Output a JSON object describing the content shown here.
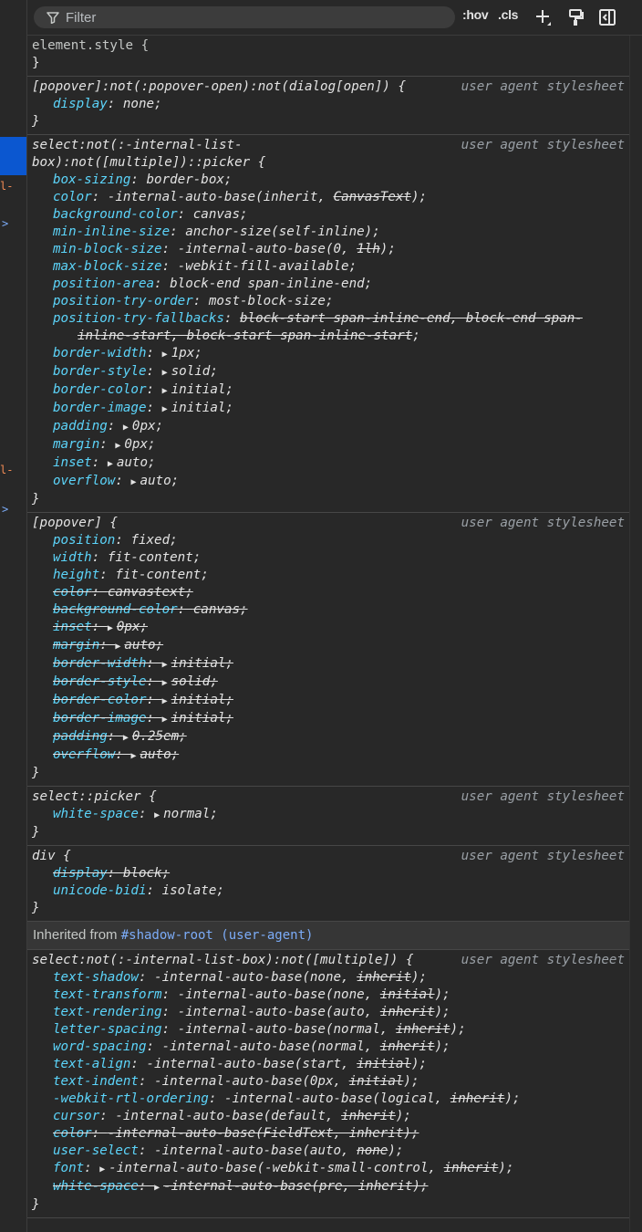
{
  "toolbar": {
    "filter_placeholder": "Filter",
    "hov_label": ":hov",
    "cls_label": ".cls"
  },
  "gutter": {
    "frag1": "l-",
    "frag2": "l-",
    "arrow1": ">",
    "arrow2": ">"
  },
  "rules": [
    {
      "selector": "element.style {",
      "origin": "",
      "close": "}"
    },
    {
      "selector": "[popover]:not(:popover-open):not(dialog[open]) {",
      "origin": "user agent stylesheet",
      "close": "}",
      "decls": [
        {
          "prop": "display",
          "val": "none;"
        }
      ]
    },
    {
      "selector": "select:not(:-internal-list-\nbox):not([multiple])::picker {",
      "origin": "user agent stylesheet",
      "close": "}",
      "decls": [
        {
          "prop": "box-sizing",
          "val": "border-box;"
        },
        {
          "prop": "color",
          "val_pre": "-internal-auto-base(inherit, ",
          "val_strike": "CanvasText",
          "val_post": ");"
        },
        {
          "prop": "background-color",
          "val": "canvas;"
        },
        {
          "prop": "min-inline-size",
          "val": "anchor-size(self-inline);"
        },
        {
          "prop": "min-block-size",
          "val_pre": "-internal-auto-base(0, ",
          "val_strike": "1lh",
          "val_post": ");"
        },
        {
          "prop": "max-block-size",
          "val": "-webkit-fill-available;"
        },
        {
          "prop": "position-area",
          "val": "block-end span-inline-end;"
        },
        {
          "prop": "position-try-order",
          "val": "most-block-size;"
        },
        {
          "prop": "position-try-fallbacks",
          "val_strike": "block-start span-inline-end, block-end span-inline-start, block-start span-inline-start",
          "val_post": ";"
        },
        {
          "prop": "border-width",
          "val": "1px;",
          "tri": true
        },
        {
          "prop": "border-style",
          "val": "solid;",
          "tri": true
        },
        {
          "prop": "border-color",
          "val": "initial;",
          "tri": true
        },
        {
          "prop": "border-image",
          "val": "initial;",
          "tri": true
        },
        {
          "prop": "padding",
          "val": "0px;",
          "tri": true
        },
        {
          "prop": "margin",
          "val": "0px;",
          "tri": true
        },
        {
          "prop": "inset",
          "val": "auto;",
          "tri": true
        },
        {
          "prop": "overflow",
          "val": "auto;",
          "tri": true
        }
      ]
    },
    {
      "selector": "[popover] {",
      "origin": "user agent stylesheet",
      "close": "}",
      "decls": [
        {
          "prop": "position",
          "val": "fixed;"
        },
        {
          "prop": "width",
          "val": "fit-content;"
        },
        {
          "prop": "height",
          "val": "fit-content;"
        },
        {
          "prop": "color",
          "val": "canvastext;",
          "over": true
        },
        {
          "prop": "background-color",
          "val": "canvas;",
          "over": true
        },
        {
          "prop": "inset",
          "val": "0px;",
          "tri": true,
          "over": true
        },
        {
          "prop": "margin",
          "val": "auto;",
          "tri": true,
          "over": true
        },
        {
          "prop": "border-width",
          "val": "initial;",
          "tri": true,
          "over": true
        },
        {
          "prop": "border-style",
          "val": "solid;",
          "tri": true,
          "over": true
        },
        {
          "prop": "border-color",
          "val": "initial;",
          "tri": true,
          "over": true
        },
        {
          "prop": "border-image",
          "val": "initial;",
          "tri": true,
          "over": true
        },
        {
          "prop": "padding",
          "val": "0.25em;",
          "tri": true,
          "over": true
        },
        {
          "prop": "overflow",
          "val": "auto;",
          "tri": true,
          "over": true
        }
      ]
    },
    {
      "selector": "select::picker {",
      "origin": "user agent stylesheet",
      "close": "}",
      "decls": [
        {
          "prop": "white-space",
          "val": "normal;",
          "tri": true
        }
      ]
    },
    {
      "selector": "div {",
      "origin": "user agent stylesheet",
      "close": "}",
      "decls": [
        {
          "prop": "display",
          "val": "block;",
          "over": true
        },
        {
          "prop": "unicode-bidi",
          "val": "isolate;"
        }
      ]
    }
  ],
  "inherited": {
    "label": "Inherited from ",
    "link": "#shadow-root (user-agent)"
  },
  "inherited_rule": {
    "selector": "select:not(:-internal-list-box):not([multiple]) {",
    "origin": "user agent stylesheet",
    "close": "}",
    "decls": [
      {
        "prop": "text-shadow",
        "val_pre": "-internal-auto-base(none, ",
        "val_strike": "inherit",
        "val_post": ");"
      },
      {
        "prop": "text-transform",
        "val_pre": "-internal-auto-base(none, ",
        "val_strike": "initial",
        "val_post": ");"
      },
      {
        "prop": "text-rendering",
        "val_pre": "-internal-auto-base(auto, ",
        "val_strike": "inherit",
        "val_post": ");"
      },
      {
        "prop": "letter-spacing",
        "val_pre": "-internal-auto-base(normal, ",
        "val_strike": "inherit",
        "val_post": ");"
      },
      {
        "prop": "word-spacing",
        "val_pre": "-internal-auto-base(normal, ",
        "val_strike": "inherit",
        "val_post": ");"
      },
      {
        "prop": "text-align",
        "val_pre": "-internal-auto-base(start, ",
        "val_strike": "initial",
        "val_post": ");"
      },
      {
        "prop": "text-indent",
        "val_pre": "-internal-auto-base(0px, ",
        "val_strike": "initial",
        "val_post": ");"
      },
      {
        "prop": "-webkit-rtl-ordering",
        "val_pre": "-internal-auto-base(logical, ",
        "val_strike": "inherit",
        "val_post": ");"
      },
      {
        "prop": "cursor",
        "val_pre": "-internal-auto-base(default, ",
        "val_strike": "inherit",
        "val_post": ");"
      },
      {
        "prop": "color",
        "val": "-internal-auto-base(FieldText, inherit);",
        "over": true
      },
      {
        "prop": "user-select",
        "val_pre": "-internal-auto-base(auto, ",
        "val_strike": "none",
        "val_post": ");"
      },
      {
        "prop": "font",
        "val_pre": "-internal-auto-base(-webkit-small-control, ",
        "val_strike": "inherit",
        "val_post": ");",
        "tri": true
      },
      {
        "prop": "white-space",
        "val": "-internal-auto-base(pre, inherit);",
        "tri": true,
        "over": true
      }
    ]
  }
}
